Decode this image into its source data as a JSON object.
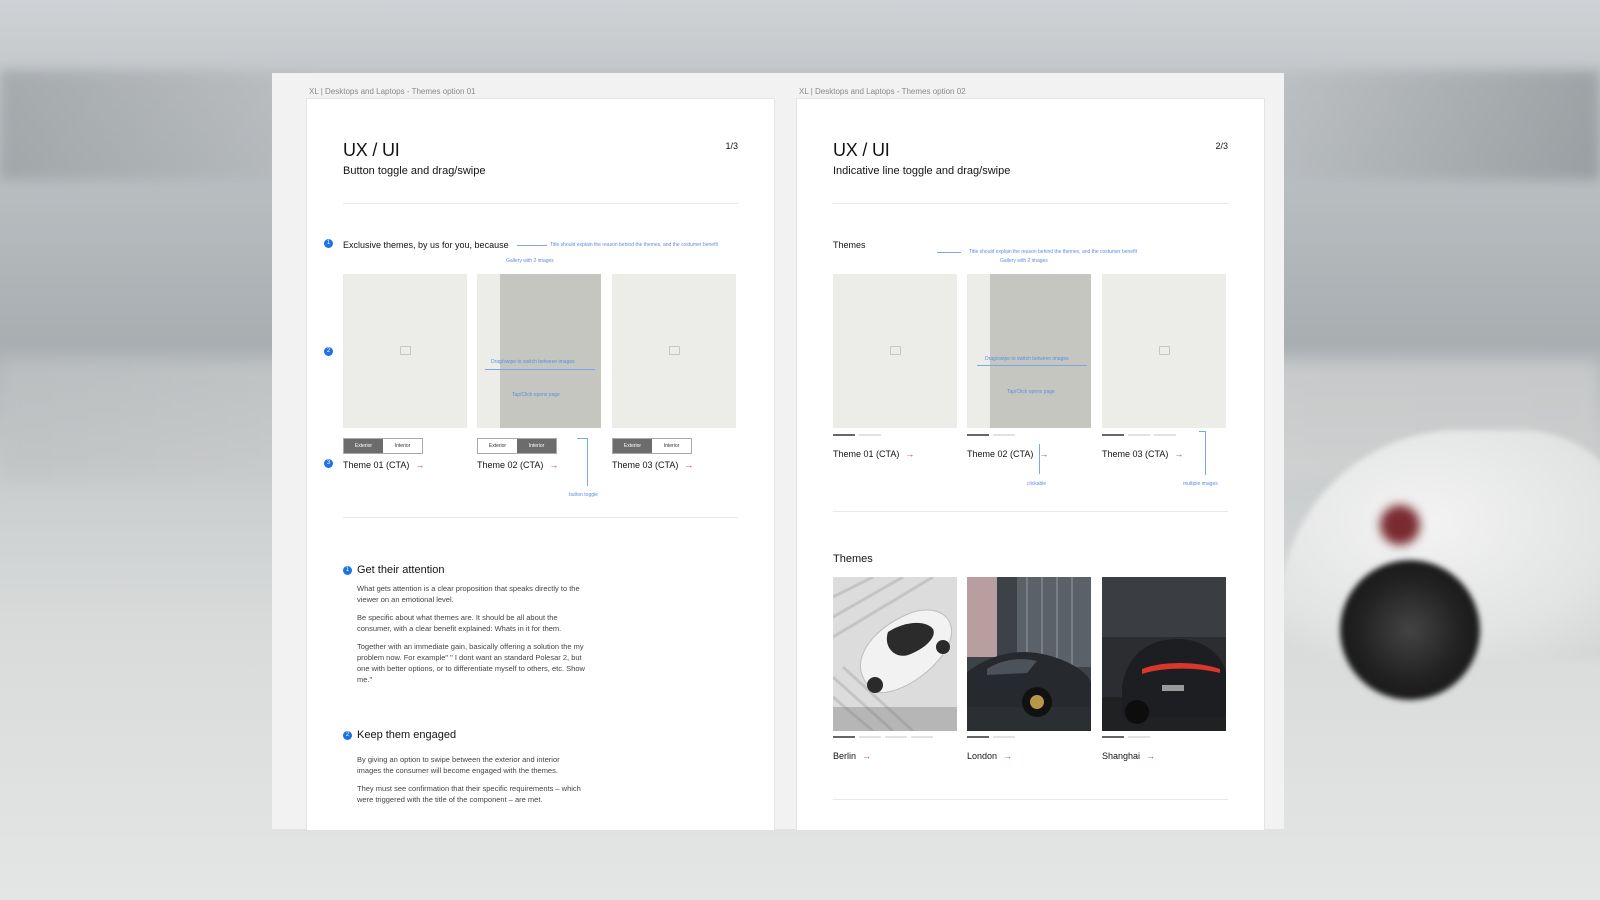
{
  "frames": [
    {
      "label": "XL | Desktops and Laptops - Themes option 01",
      "title": "UX / UI",
      "subtitle": "Button toggle and drag/swipe",
      "page": "1/3",
      "section_title": "Exclusive themes, by us for you, because",
      "notes": {
        "title_note": "Title should explain the reason behind the themes, and the costumer benefit",
        "gallery": "Gallery with 2 images",
        "drag": "Drag/swipe to switch between images",
        "tap": "Tap/Click opens page",
        "button_toggle": "button toggle"
      },
      "markers": [
        "1",
        "2",
        "3"
      ],
      "toggles": [
        {
          "left": "Exterior",
          "right": "Interior"
        },
        {
          "left": "Exterior",
          "right": "Interior"
        },
        {
          "left": "Exterior",
          "right": "Interior"
        }
      ],
      "ctas": [
        "Theme 01 (CTA)",
        "Theme 02 (CTA)",
        "Theme 03 (CTA)"
      ],
      "arrow": "→",
      "blocks": [
        {
          "marker": "1",
          "heading": "Get their attention",
          "paragraphs": [
            "What gets attention is a clear proposition that speaks directly to the viewer on an emotional level.",
            "Be specific about what themes are.  It should be all about the consumer, with a clear benefit explained: Whats in it for them.",
            "Together with an immediate gain, basically offering a solution the my problem now.  For example\" \" I dont want an standard Polesar 2, but one with better options, or to differentiate myself to others, etc. Show me.\""
          ]
        },
        {
          "marker": "2",
          "heading": "Keep them engaged",
          "paragraphs": [
            "By giving an option to swipe between the exterior and interior images the consumer will become  engaged with the themes.",
            "They must see confirmation that their specific requirements – which were triggered with the title of the component –  are met."
          ]
        }
      ]
    },
    {
      "label": "XL | Desktops and Laptops - Themes option 02",
      "title": "UX / UI",
      "subtitle": "Indicative line toggle and drag/swipe",
      "page": "2/3",
      "section_title": "Themes",
      "notes": {
        "title_note": "Title should explain the reason behind the themes, and the costumer benefit",
        "gallery": "Gallery with 2 images",
        "drag": "Drag/swipe to switch between images",
        "tap": "Tap/Click opens page",
        "clickable": "clickable",
        "multiple": "multiple images"
      },
      "ctas": [
        "Theme 01 (CTA)",
        "Theme 02 (CTA)",
        "Theme 03 (CTA)"
      ],
      "section2_title": "Themes",
      "cities": [
        "Berlin",
        "London",
        "Shanghai"
      ],
      "arrow": "→"
    }
  ],
  "colors": {
    "accent_blue": "#1a73e8",
    "cta_arrow": "#d33b2f"
  }
}
